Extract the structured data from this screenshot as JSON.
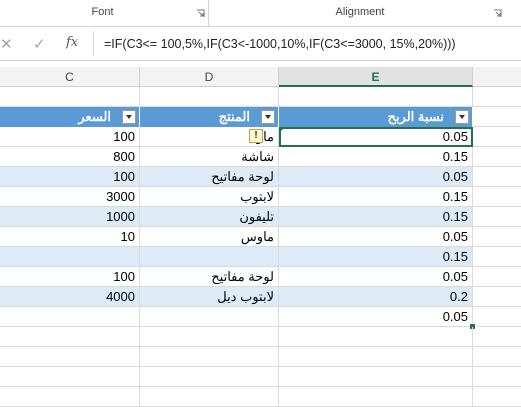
{
  "ribbon": {
    "font_label": "Font",
    "alignment_label": "Alignment"
  },
  "formula_bar": {
    "cancel_symbol": "✕",
    "enter_symbol": "✓",
    "fx_label": "fx",
    "formula": "=IF(C3<= 100,5%,IF(C3<-1000,10%,IF(C3<=3000, 15%,20%)))"
  },
  "columns": {
    "c": "C",
    "d": "D",
    "e": "E"
  },
  "table": {
    "headers": [
      "السعر",
      "المنتج",
      "نسبة الربح"
    ],
    "rows": [
      {
        "price": "100",
        "product": "ماو",
        "rate": "0.05"
      },
      {
        "price": "800",
        "product": "شاشة",
        "rate": "0.15"
      },
      {
        "price": "100",
        "product": "لوحة مفاتيح",
        "rate": "0.05"
      },
      {
        "price": "3000",
        "product": "لابتوب",
        "rate": "0.15"
      },
      {
        "price": "1000",
        "product": "تليفون",
        "rate": "0.15"
      },
      {
        "price": "10",
        "product": "ماوس",
        "rate": "0.05"
      },
      {
        "price": "",
        "product": "",
        "rate": "0.15"
      },
      {
        "price": "100",
        "product": "لوحة مفاتيح",
        "rate": "0.05"
      },
      {
        "price": "4000",
        "product": "لابتوب ديل",
        "rate": "0.2"
      },
      {
        "price": "",
        "product": "",
        "rate": "0.05"
      }
    ]
  },
  "warning_symbol": "!",
  "colors": {
    "header_blue": "#5b9bd5",
    "band_blue": "#ddebf7",
    "excel_green": "#217346"
  }
}
